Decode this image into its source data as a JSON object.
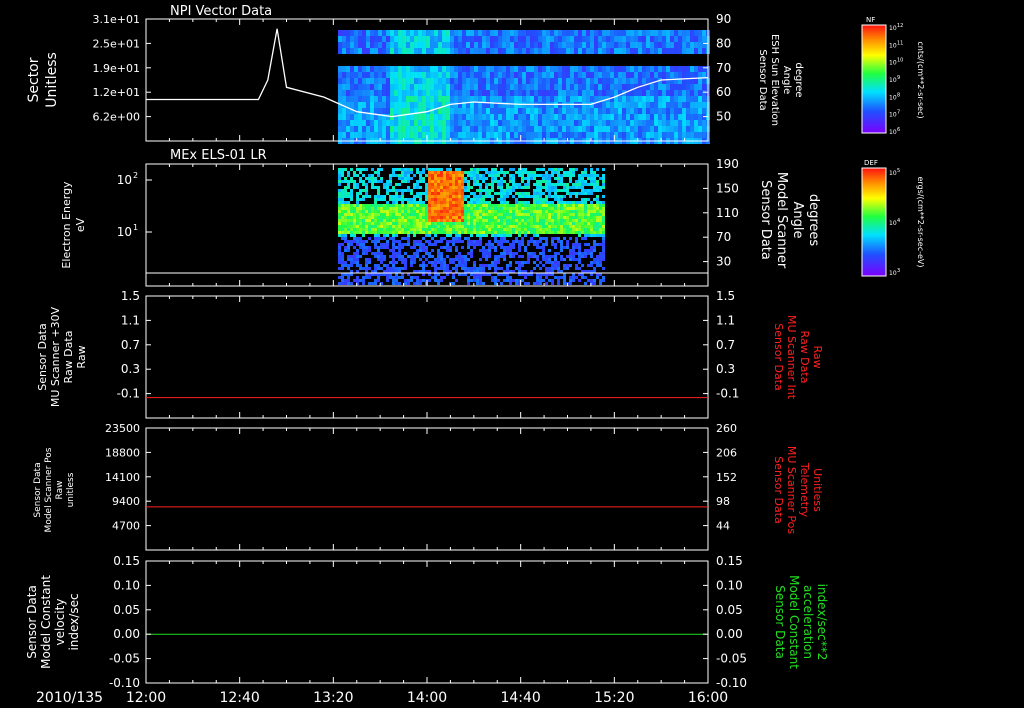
{
  "chart_data": [
    {
      "type": "heatmap",
      "title": "NPI Vector Data",
      "ylabel_left": [
        "Sector",
        "Unitless"
      ],
      "ylabel_right": [
        "Sensor Data",
        "ESH Sun Elevation",
        "Angle",
        "degree"
      ],
      "yticks_left": [
        "3.1e+01",
        "2.5e+01",
        "1.9e+01",
        "1.2e+01",
        "6.2e+00"
      ],
      "yticks_right": [
        "90",
        "80",
        "70",
        "60",
        "50"
      ],
      "colorbar_label": "cnts/(cm**2-sr-sec)",
      "colorbar_name": "NF",
      "colorbar_ticks": [
        "10^12",
        "10^11",
        "10^10",
        "10^9",
        "10^8",
        "10^7",
        "10^6"
      ],
      "line_series": {
        "name": "ESH Sun Elevation Angle",
        "x": [
          "12:00",
          "12:40",
          "12:48",
          "12:52",
          "12:56",
          "13:00",
          "13:16",
          "13:30",
          "13:45",
          "14:00",
          "14:10",
          "14:20",
          "14:40",
          "15:00",
          "15:10",
          "15:20",
          "15:30",
          "15:40",
          "16:00"
        ],
        "y": [
          57,
          57,
          57,
          65,
          86,
          62,
          58,
          52,
          50,
          52,
          55,
          56,
          55,
          55,
          55,
          58,
          62,
          65,
          66
        ]
      },
      "data_extent_x": [
        "13:22",
        "16:00"
      ]
    },
    {
      "type": "heatmap",
      "title": "MEx ELS-01 LR",
      "ylabel_left": [
        "Electron Energy",
        "eV"
      ],
      "ylabel_right": [
        "Sensor Data",
        "Model Scanner",
        "Angle",
        "degrees"
      ],
      "yticks_left": [
        "10^2",
        "10^1"
      ],
      "yticks_right": [
        "190",
        "150",
        "110",
        "70",
        "30"
      ],
      "colorbar_label": "ergs/(cm**2-sr-sec-eV)",
      "colorbar_name": "DEF",
      "colorbar_ticks": [
        "10^5",
        "10^4",
        "10^3"
      ],
      "line_series": {
        "name": "Model Scanner Angle",
        "y": 10
      },
      "data_extent_x": [
        "13:22",
        "15:15"
      ]
    },
    {
      "type": "line",
      "ylabel_left": [
        "Sensor Data",
        "MU Scanner +30V",
        "Raw Data",
        "Raw"
      ],
      "ylabel_right": [
        "Sensor Data",
        "MU Scanner Int",
        "Raw Data",
        "Raw"
      ],
      "ylim": [
        -0.3,
        1.5
      ],
      "yticks": [
        "1.5",
        "1.1",
        "0.7",
        "0.3",
        "-0.1"
      ],
      "series": [
        {
          "y": 0.0,
          "color": "#ff2020"
        }
      ]
    },
    {
      "type": "line",
      "ylabel_left": [
        "Sensor Data",
        "Model Scanner Pos",
        "Raw",
        "unitless"
      ],
      "ylabel_right": [
        "Sensor Data",
        "MU Scanner Pos",
        "Telemetry",
        "Unitless"
      ],
      "ylim": [
        0,
        23500
      ],
      "yticks_left": [
        "23500",
        "18800",
        "14100",
        "9400",
        "4700"
      ],
      "yticks_right": [
        "260",
        "206",
        "152",
        "98",
        "44"
      ],
      "series": [
        {
          "y": 8300,
          "color": "#ff2020"
        }
      ]
    },
    {
      "type": "line",
      "ylabel_left": [
        "Sensor Data",
        "Model Constant",
        "velocity",
        "index/sec"
      ],
      "ylabel_right": [
        "Sensor Data",
        "Model Constant",
        "acceleration",
        "index/sec**2"
      ],
      "ylim": [
        -0.1,
        0.15
      ],
      "yticks": [
        "0.15",
        "0.10",
        "0.05",
        "0.00",
        "-0.05",
        "-0.10"
      ],
      "series": [
        {
          "y": 0.0,
          "color": "#20e020"
        }
      ]
    }
  ],
  "x_axis": {
    "date_label": "2010/135",
    "ticks": [
      "12:00",
      "12:40",
      "13:20",
      "14:00",
      "14:40",
      "15:20",
      "16:00"
    ]
  },
  "colors": {
    "background": "#000000",
    "axis": "#ffffff",
    "red_label": "#ff2020",
    "green_label": "#20e020"
  }
}
